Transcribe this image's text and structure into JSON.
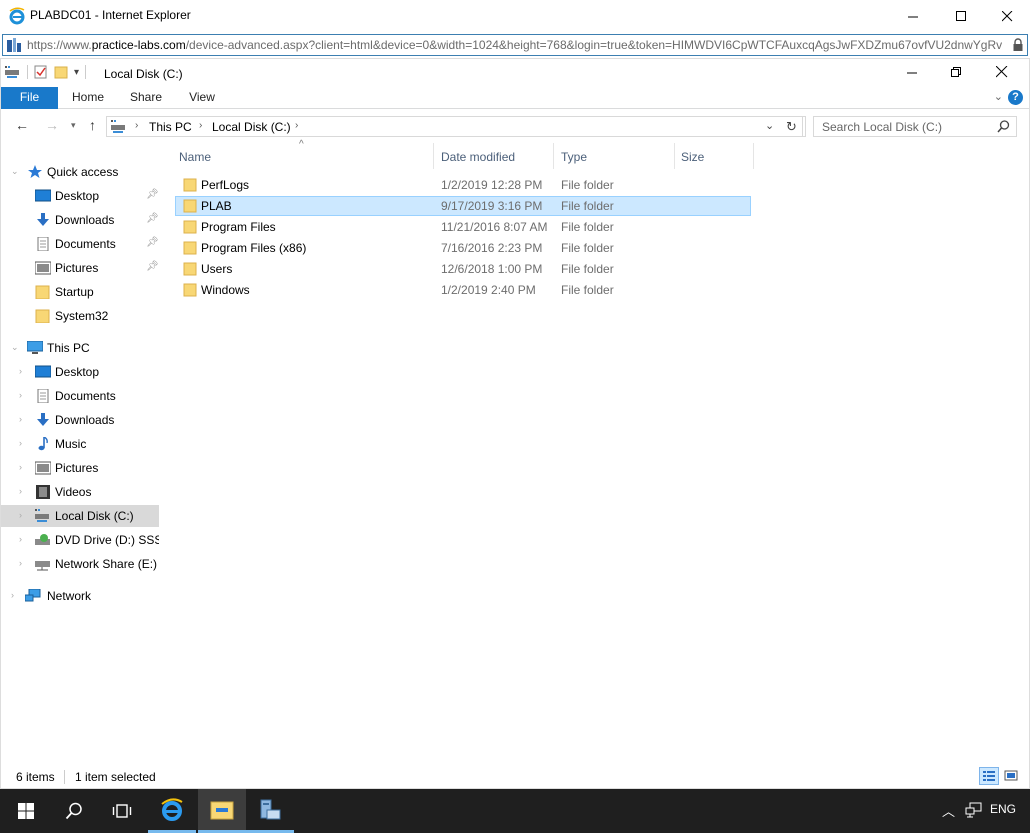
{
  "browser": {
    "title": "PLABDC01 - Internet Explorer",
    "url_prefix": "https://www.",
    "url_host": "practice-labs.com",
    "url_rest": "/device-advanced.aspx?client=html&device=0&width=1024&height=768&login=true&token=HIMWDVI6CpWTCFAuxcqAgsJwFXDZmu67ovfVU2dnwYgRv"
  },
  "explorer": {
    "title": "Local Disk (C:)",
    "ribbon_tabs": [
      "File",
      "Home",
      "Share",
      "View"
    ],
    "help": "?",
    "breadcrumb": [
      "This PC",
      "Local Disk (C:)"
    ],
    "search_placeholder": "Search Local Disk (C:)",
    "nav": {
      "quick_access": "Quick access",
      "quick_items": [
        "Desktop",
        "Downloads",
        "Documents",
        "Pictures",
        "Startup",
        "System32"
      ],
      "this_pc": "This PC",
      "pc_items": [
        "Desktop",
        "Documents",
        "Downloads",
        "Music",
        "Pictures",
        "Videos",
        "Local Disk (C:)",
        "DVD Drive (D:) SSS_X",
        "Network Share (E:)"
      ],
      "network": "Network"
    },
    "columns": [
      "Name",
      "Date modified",
      "Type",
      "Size"
    ],
    "files": [
      {
        "name": "PerfLogs",
        "date": "1/2/2019 12:28 PM",
        "type": "File folder"
      },
      {
        "name": "PLAB",
        "date": "9/17/2019 3:16 PM",
        "type": "File folder"
      },
      {
        "name": "Program Files",
        "date": "11/21/2016 8:07 AM",
        "type": "File folder"
      },
      {
        "name": "Program Files (x86)",
        "date": "7/16/2016 2:23 PM",
        "type": "File folder"
      },
      {
        "name": "Users",
        "date": "12/6/2018 1:00 PM",
        "type": "File folder"
      },
      {
        "name": "Windows",
        "date": "1/2/2019 2:40 PM",
        "type": "File folder"
      }
    ],
    "status_items": "6 items",
    "status_selected": "1 item selected"
  },
  "taskbar": {
    "lang": "ENG"
  },
  "colors": {
    "accent": "#1979ca",
    "selection": "#cce8ff",
    "taskbar": "#1f1f1f"
  }
}
